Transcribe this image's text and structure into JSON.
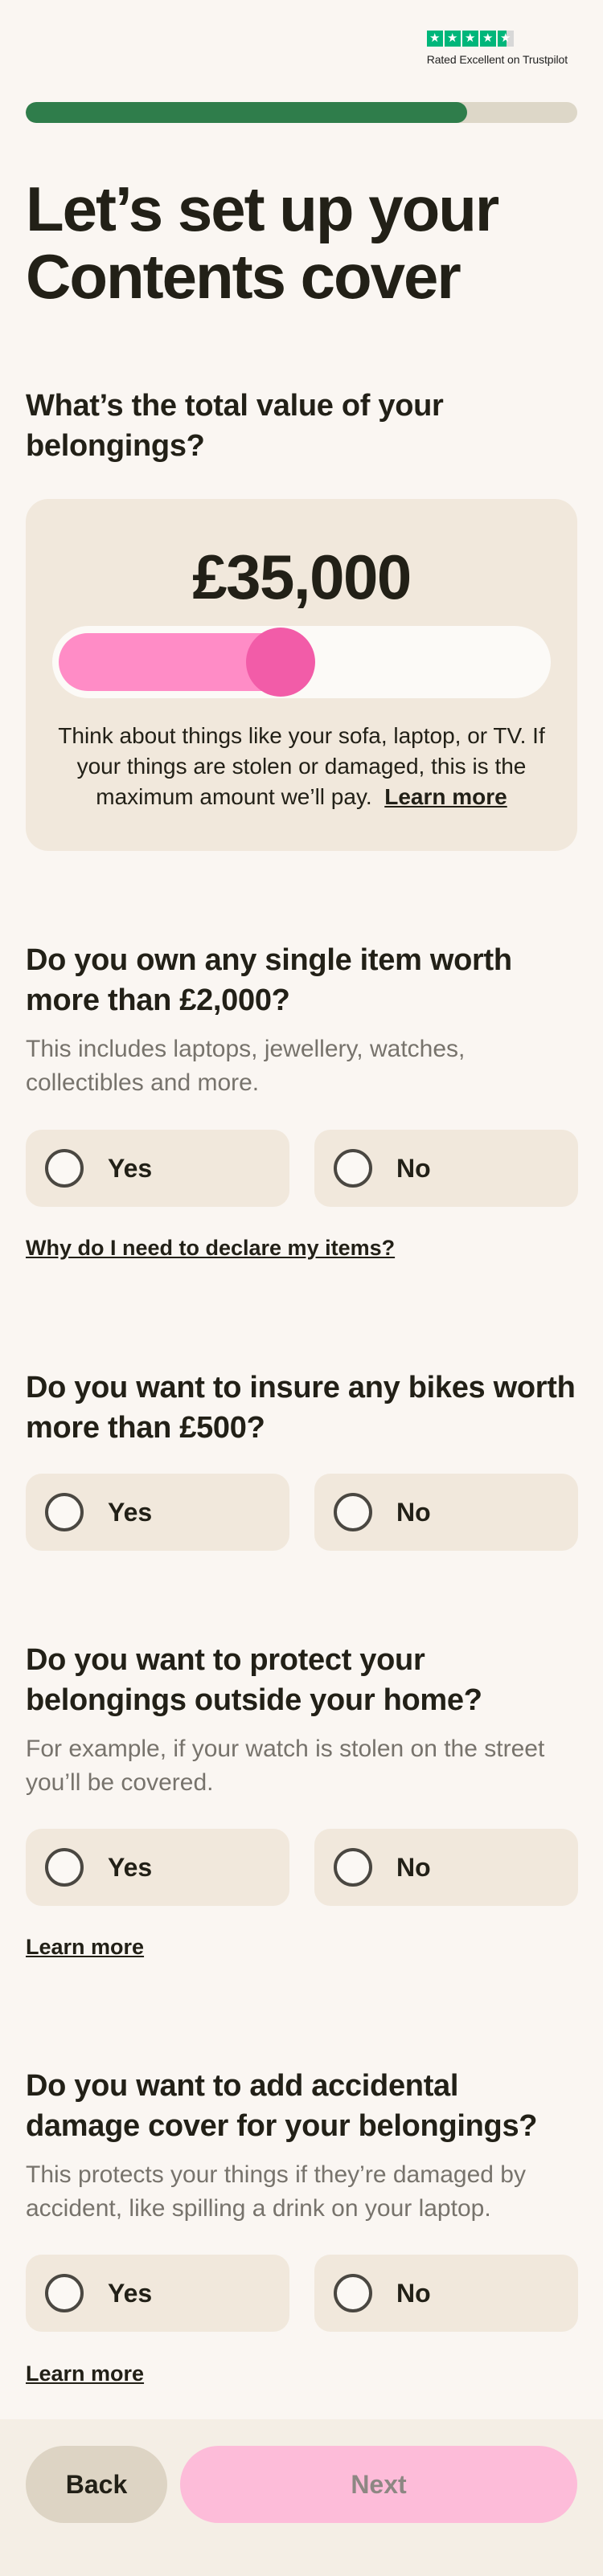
{
  "trustpilot": {
    "rating_text": "Rated Excellent on Trustpilot",
    "star_icon": "star-icon",
    "brand_color": "#00b67a"
  },
  "progress": {
    "fraction": 0.8,
    "color": "#2f7d4b"
  },
  "page_title": "Let’s set up your Contents cover",
  "belongings": {
    "title": "What’s the total value of your belongings?",
    "value": "£35,000",
    "slider_fraction": 0.45,
    "description": "Think about things like your sofa, laptop, or TV. If your things are stolen or damaged, this is the maximum amount we’ll pay.",
    "learn_more": "Learn more"
  },
  "questions": [
    {
      "title": "Do you own any single item worth more than £2,000?",
      "hint": "This includes laptops, jewellery, watches, collectibles and more.",
      "yes": "Yes",
      "no": "No",
      "link": "Why do I need to declare my items?"
    },
    {
      "title": "Do you want to insure any bikes worth more than £500?",
      "yes": "Yes",
      "no": "No"
    },
    {
      "title": "Do you want to protect your belongings outside your home?",
      "hint": "For example, if your watch is stolen on the street you’ll be covered.",
      "yes": "Yes",
      "no": "No",
      "link": "Learn more"
    },
    {
      "title": "Do you want to add accidental damage cover for your belongings?",
      "hint": "This protects your things if they’re damaged by accident, like spilling a drink on your laptop.",
      "yes": "Yes",
      "no": "No",
      "link": "Learn more"
    }
  ],
  "footer": {
    "back": "Back",
    "next": "Next"
  },
  "colors": {
    "accent_pink": "#f25ca8",
    "card_bg": "#f1e8dc",
    "page_bg": "#faf6f2"
  }
}
